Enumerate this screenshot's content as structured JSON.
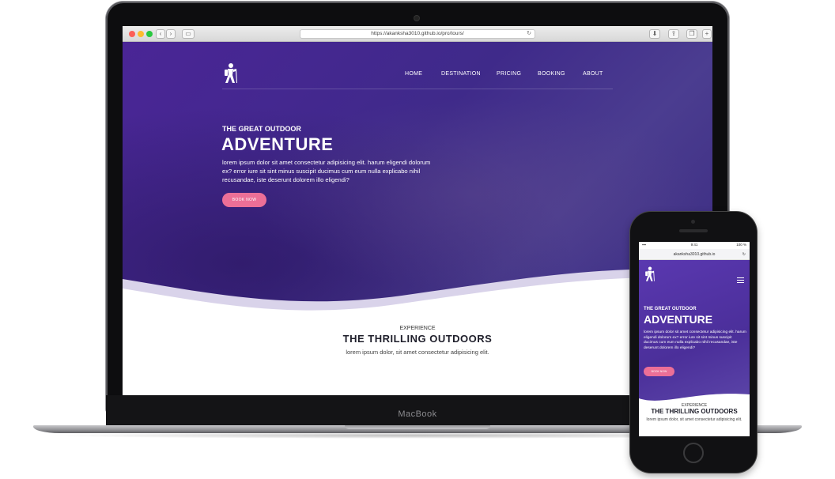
{
  "laptop": {
    "brand": "MacBook",
    "browser": {
      "url": "https://akanksha3010.github.io/pro/tours/"
    },
    "site": {
      "nav": [
        "HOME",
        "DESTINATION",
        "PRICING",
        "BOOKING",
        "ABOUT"
      ],
      "hero": {
        "eyebrow": "THE GREAT OUTDOOR",
        "title": "ADVENTURE",
        "lead": "lorem ipsum dolor sit amet consectetur adipisicing elit. harum eligendi dolorum ex? error iure sit sint minus suscipit ducimus cum eum nulla explicabo nihil recusandae, iste deserunt dolorem illo eligendi?",
        "button": "BOOK NOW"
      },
      "experience": {
        "small": "EXPERIENCE",
        "title": "THE THRILLING OUTDOORS",
        "text": "lorem ipsum dolor, sit amet consectetur adipisicing elit."
      }
    }
  },
  "phone": {
    "status": {
      "time": "9:41",
      "battery": "100 %"
    },
    "url": "akanksha3010.github.io",
    "site": {
      "hero": {
        "eyebrow": "THE GREAT OUTDOOR",
        "title": "ADVENTURE",
        "lead": "lorem ipsum dolor sit amet consectetur adipisicing elit. harum eligendi dolorum ex? error iure sit sint minus suscipit ducimus cum eum nulla explicabo nihil recusandae, iste deserunt dolorem illo eligendi?",
        "button": "BOOK NOW"
      },
      "experience": {
        "small": "EXPERIENCE",
        "title": "THE THRILLING OUTDOORS",
        "text": "lorem ipsum dolor, sit amet consectetur adipisicing elit."
      }
    }
  },
  "colors": {
    "hero_purple": "#4a2596",
    "button_pink": "#ec6f97",
    "heading_dark": "#1e1e2a"
  }
}
